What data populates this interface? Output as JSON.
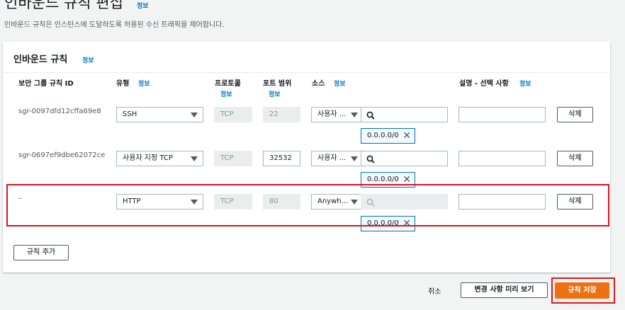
{
  "page": {
    "title": "인바운드 규칙 편집",
    "title_info": "정보",
    "description": "인바운드 규칙은 인스턴스에 도달하도록 허용된 수신 트래픽을 제어합니다."
  },
  "panel": {
    "title": "인바운드 규칙",
    "title_info": "정보"
  },
  "columns": {
    "rule_id": "보안 그룹 규칙 ID",
    "type": "유형",
    "type_info": "정보",
    "protocol": "프로토콜",
    "protocol_info": "정보",
    "port_range": "포트 범위",
    "port_info": "정보",
    "source": "소스",
    "source_info": "정보",
    "description": "설명 - 선택 사항",
    "description_info": "정보"
  },
  "rows": [
    {
      "rule_id": "sgr-0097dfd12cffa69e8",
      "type": "SSH",
      "protocol": "TCP",
      "port": "22",
      "source_type": "사용자 ...",
      "cidr": "0.0.0.0/0",
      "delete_label": "삭제"
    },
    {
      "rule_id": "sgr-0697ef9dbe62072ce",
      "type": "사용자 지정 TCP",
      "protocol": "TCP",
      "port": "32532",
      "source_type": "사용자 ...",
      "cidr": "0.0.0.0/0",
      "delete_label": "삭제"
    },
    {
      "rule_id": "–",
      "type": "HTTP",
      "protocol": "TCP",
      "port": "80",
      "source_type": "Anywh...",
      "cidr": "0.0.0.0/0",
      "delete_label": "삭제"
    }
  ],
  "add_rule_label": "규칙 추가",
  "footer": {
    "cancel_label": "취소",
    "preview_label": "변경 사항 미리 보기",
    "save_label": "규칙 저장"
  },
  "colors": {
    "accent": "#ec7211",
    "link": "#0073bb",
    "highlight": "#e0141e"
  }
}
